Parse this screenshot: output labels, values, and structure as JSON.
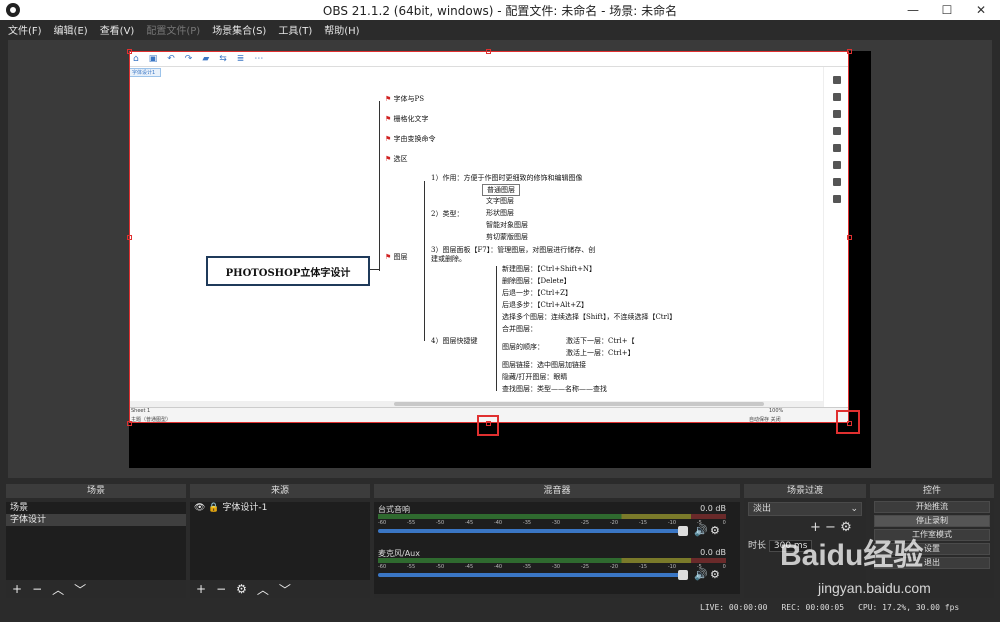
{
  "window": {
    "title": "OBS 21.1.2 (64bit, windows) - 配置文件: 未命名 - 场景: 未命名",
    "minimize": "—",
    "maximize": "☐",
    "close": "✕"
  },
  "menu": {
    "items": [
      "文件(F)",
      "编辑(E)",
      "查看(V)",
      "配置文件(P)",
      "场景集合(S)",
      "工具(T)",
      "帮助(H)"
    ]
  },
  "source_capture": {
    "tab": "字体设计1",
    "sheet": "Sheet 1",
    "status_left": "主题（普通图型）",
    "status_right": "自动保存  关闭",
    "zoom": "100%",
    "root": "PHOTOSHOP立体字设计",
    "top_nodes": [
      "字体与PS",
      "栅格化文字",
      "字由变换命令",
      "选区",
      "图层"
    ],
    "layer_items": [
      "1）作用：方便于作图时更细致的修饰和编辑图像",
      "2）类型：",
      "3）图层面板【F7】：管理图层，对图层进行储存、创",
      "建或删除。",
      "4）图层快捷键"
    ],
    "types": [
      "普通图层",
      "文字图层",
      "形状图层",
      "智能对象图层",
      "剪切蒙版图层"
    ],
    "shortcuts": [
      "新建图层：【Ctrl+Shift+N】",
      "删除图层：【Delete】",
      "后退一步：【Ctrl+Z】",
      "后退多步：【Ctrl+Alt+Z】",
      "选择多个图层：连续选择【Shift】，不连续选择【Ctrl】",
      "合并图层：",
      "图层的顺序：",
      "激活下一层：Ctrl+【",
      "激活上一层：Ctrl+】",
      "图层链接：选中图层加链接",
      "隐藏/打开图层：眼睛",
      "查找图层：类型——名称——查找"
    ]
  },
  "docks": {
    "scenes": {
      "title": "场景",
      "items": [
        "场景",
        "字体设计"
      ]
    },
    "sources": {
      "title": "来源",
      "items": [
        "字体设计-1"
      ]
    },
    "mixer": {
      "title": "混音器",
      "channels": [
        {
          "name": "台式音响",
          "db": "0.0 dB"
        },
        {
          "name": "麦克风/Aux",
          "db": "0.0 dB"
        }
      ],
      "scale": [
        "-60",
        "-55",
        "-50",
        "-45",
        "-40",
        "-35",
        "-30",
        "-25",
        "-20",
        "-15",
        "-10",
        "-5",
        "0"
      ]
    },
    "transitions": {
      "title": "场景过渡",
      "selected": "淡出",
      "duration_label": "时长",
      "duration_value": "300 ms"
    },
    "controls": {
      "title": "控件",
      "buttons": [
        "开始推流",
        "停止录制",
        "工作室模式",
        "设置",
        "退出"
      ]
    }
  },
  "status": {
    "live": "LIVE: 00:00:00",
    "rec": "REC: 00:00:05",
    "cpu": "CPU: 17.2%, 30.00 fps"
  },
  "watermark": {
    "brand": "Baidu经验",
    "url": "jingyan.baidu.com"
  }
}
